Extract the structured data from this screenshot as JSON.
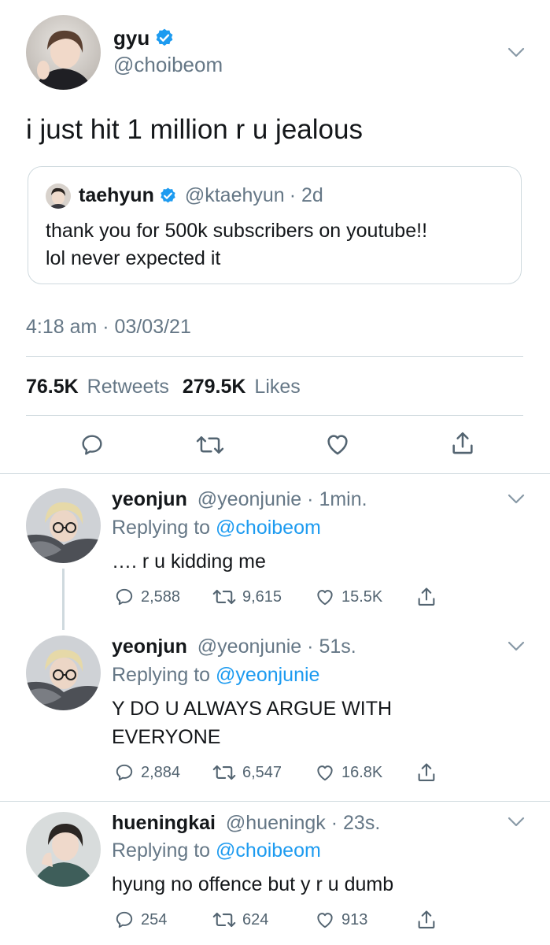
{
  "main_tweet": {
    "author_name": "gyu",
    "author_handle": "@choibeom",
    "text": "i just hit 1 million r u jealous",
    "quoted": {
      "author_name": "taehyun",
      "author_handle": "@ktaehyun",
      "time": "· 2d",
      "line1": "thank you for 500k subscribers on youtube!!",
      "line2": "lol never expected it"
    },
    "timestamp": "4:18 am · 03/03/21",
    "retweets_count": "76.5K",
    "retweets_label": "Retweets",
    "likes_count": "279.5K",
    "likes_label": "Likes"
  },
  "replies": [
    {
      "author_name": "yeonjun",
      "author_handle": "@yeonjunie",
      "time": "· 1min.",
      "replying_label": "Replying to",
      "replying_to": "@choibeom",
      "text_lines": [
        "…. r u kidding me"
      ],
      "replies": "2,588",
      "retweets": "9,615",
      "likes": "15.5K"
    },
    {
      "author_name": "yeonjun",
      "author_handle": "@yeonjunie",
      "time": "· 51s.",
      "replying_label": "Replying to",
      "replying_to": "@yeonjunie",
      "text_lines": [
        "Y DO U ALWAYS ARGUE WITH",
        "EVERYONE"
      ],
      "replies": "2,884",
      "retweets": "6,547",
      "likes": "16.8K"
    },
    {
      "author_name": "hueningkai",
      "author_handle": "@hueningk",
      "time": "· 23s.",
      "replying_label": "Replying to",
      "replying_to": "@choibeom",
      "text_lines": [
        "hyung no offence but y r u dumb"
      ],
      "replies": "254",
      "retweets": "624",
      "likes": "913"
    }
  ],
  "colors": {
    "accent": "#1d9bf0",
    "secondary_text": "#657786",
    "divider": "#cfd9de"
  },
  "icons": [
    "verified-icon",
    "chevron-down-icon",
    "reply-icon",
    "retweet-icon",
    "like-icon",
    "share-icon"
  ]
}
